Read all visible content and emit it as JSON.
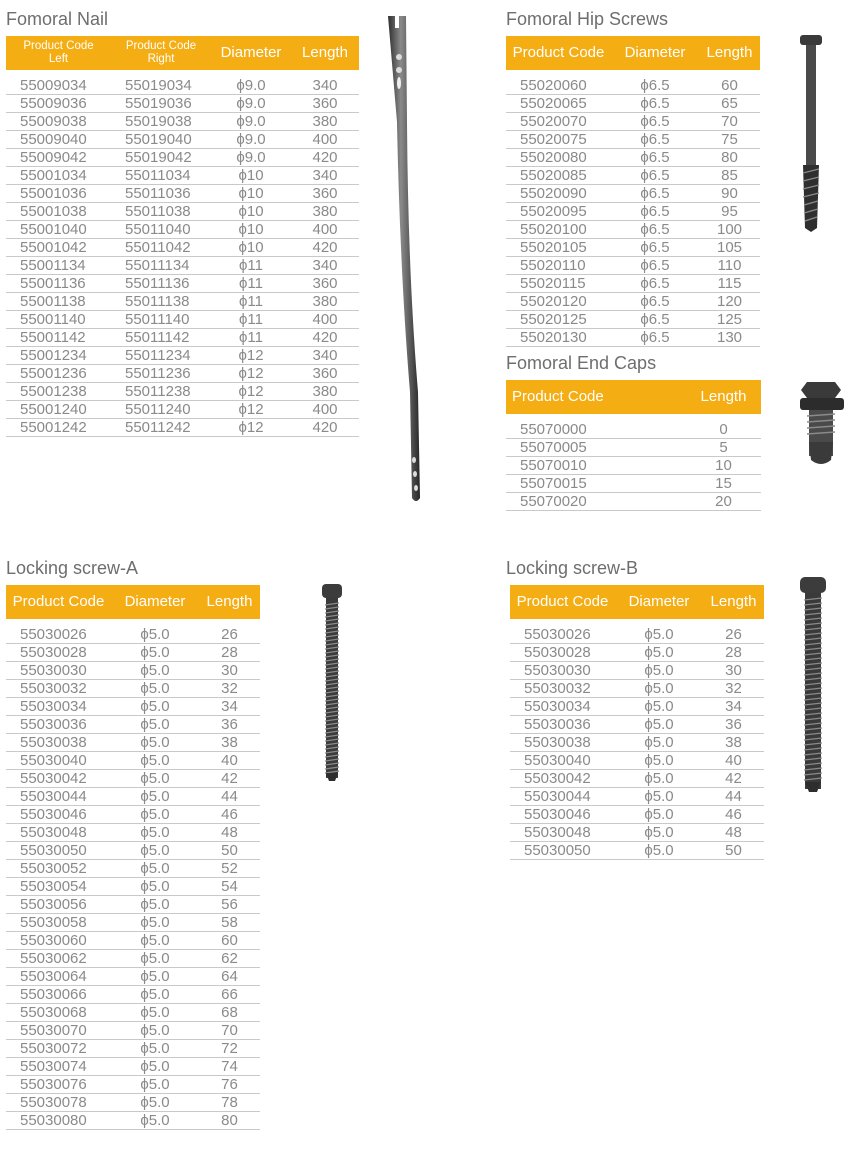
{
  "nail": {
    "title": "Fomoral Nail",
    "headers": {
      "left_top": "Product Code",
      "left_bottom": "Left",
      "right_top": "Product Code",
      "right_bottom": "Right",
      "diameter": "Diameter",
      "length": "Length"
    },
    "rows": [
      [
        "55009034",
        "55019034",
        "ϕ9.0",
        "340"
      ],
      [
        "55009036",
        "55019036",
        "ϕ9.0",
        "360"
      ],
      [
        "55009038",
        "55019038",
        "ϕ9.0",
        "380"
      ],
      [
        "55009040",
        "55019040",
        "ϕ9.0",
        "400"
      ],
      [
        "55009042",
        "55019042",
        "ϕ9.0",
        "420"
      ],
      [
        "55001034",
        "55011034",
        "ϕ10",
        "340"
      ],
      [
        "55001036",
        "55011036",
        "ϕ10",
        "360"
      ],
      [
        "55001038",
        "55011038",
        "ϕ10",
        "380"
      ],
      [
        "55001040",
        "55011040",
        "ϕ10",
        "400"
      ],
      [
        "55001042",
        "55011042",
        "ϕ10",
        "420"
      ],
      [
        "55001134",
        "55011134",
        "ϕ11",
        "340"
      ],
      [
        "55001136",
        "55011136",
        "ϕ11",
        "360"
      ],
      [
        "55001138",
        "55011138",
        "ϕ11",
        "380"
      ],
      [
        "55001140",
        "55011140",
        "ϕ11",
        "400"
      ],
      [
        "55001142",
        "55011142",
        "ϕ11",
        "420"
      ],
      [
        "55001234",
        "55011234",
        "ϕ12",
        "340"
      ],
      [
        "55001236",
        "55011236",
        "ϕ12",
        "360"
      ],
      [
        "55001238",
        "55011238",
        "ϕ12",
        "380"
      ],
      [
        "55001240",
        "55011240",
        "ϕ12",
        "400"
      ],
      [
        "55001242",
        "55011242",
        "ϕ12",
        "420"
      ]
    ]
  },
  "hip": {
    "title": "Fomoral Hip Screws",
    "headers": {
      "code": "Product Code",
      "diameter": "Diameter",
      "length": "Length"
    },
    "rows": [
      [
        "55020060",
        "ϕ6.5",
        "60"
      ],
      [
        "55020065",
        "ϕ6.5",
        "65"
      ],
      [
        "55020070",
        "ϕ6.5",
        "70"
      ],
      [
        "55020075",
        "ϕ6.5",
        "75"
      ],
      [
        "55020080",
        "ϕ6.5",
        "80"
      ],
      [
        "55020085",
        "ϕ6.5",
        "85"
      ],
      [
        "55020090",
        "ϕ6.5",
        "90"
      ],
      [
        "55020095",
        "ϕ6.5",
        "95"
      ],
      [
        "55020100",
        "ϕ6.5",
        "100"
      ],
      [
        "55020105",
        "ϕ6.5",
        "105"
      ],
      [
        "55020110",
        "ϕ6.5",
        "110"
      ],
      [
        "55020115",
        "ϕ6.5",
        "115"
      ],
      [
        "55020120",
        "ϕ6.5",
        "120"
      ],
      [
        "55020125",
        "ϕ6.5",
        "125"
      ],
      [
        "55020130",
        "ϕ6.5",
        "130"
      ]
    ]
  },
  "caps": {
    "title": "Fomoral End Caps",
    "headers": {
      "code": "Product Code",
      "length": "Length"
    },
    "rows": [
      [
        "55070000",
        "0"
      ],
      [
        "55070005",
        "5"
      ],
      [
        "55070010",
        "10"
      ],
      [
        "55070015",
        "15"
      ],
      [
        "55070020",
        "20"
      ]
    ]
  },
  "lockA": {
    "title": "Locking screw-A",
    "headers": {
      "code": "Product Code",
      "diameter": "Diameter",
      "length": "Length"
    },
    "rows": [
      [
        "55030026",
        "ϕ5.0",
        "26"
      ],
      [
        "55030028",
        "ϕ5.0",
        "28"
      ],
      [
        "55030030",
        "ϕ5.0",
        "30"
      ],
      [
        "55030032",
        "ϕ5.0",
        "32"
      ],
      [
        "55030034",
        "ϕ5.0",
        "34"
      ],
      [
        "55030036",
        "ϕ5.0",
        "36"
      ],
      [
        "55030038",
        "ϕ5.0",
        "38"
      ],
      [
        "55030040",
        "ϕ5.0",
        "40"
      ],
      [
        "55030042",
        "ϕ5.0",
        "42"
      ],
      [
        "55030044",
        "ϕ5.0",
        "44"
      ],
      [
        "55030046",
        "ϕ5.0",
        "46"
      ],
      [
        "55030048",
        "ϕ5.0",
        "48"
      ],
      [
        "55030050",
        "ϕ5.0",
        "50"
      ],
      [
        "55030052",
        "ϕ5.0",
        "52"
      ],
      [
        "55030054",
        "ϕ5.0",
        "54"
      ],
      [
        "55030056",
        "ϕ5.0",
        "56"
      ],
      [
        "55030058",
        "ϕ5.0",
        "58"
      ],
      [
        "55030060",
        "ϕ5.0",
        "60"
      ],
      [
        "55030062",
        "ϕ5.0",
        "62"
      ],
      [
        "55030064",
        "ϕ5.0",
        "64"
      ],
      [
        "55030066",
        "ϕ5.0",
        "66"
      ],
      [
        "55030068",
        "ϕ5.0",
        "68"
      ],
      [
        "55030070",
        "ϕ5.0",
        "70"
      ],
      [
        "55030072",
        "ϕ5.0",
        "72"
      ],
      [
        "55030074",
        "ϕ5.0",
        "74"
      ],
      [
        "55030076",
        "ϕ5.0",
        "76"
      ],
      [
        "55030078",
        "ϕ5.0",
        "78"
      ],
      [
        "55030080",
        "ϕ5.0",
        "80"
      ]
    ]
  },
  "lockB": {
    "title": "Locking screw-B",
    "headers": {
      "code": "Product Code",
      "diameter": "Diameter",
      "length": "Length"
    },
    "rows": [
      [
        "55030026",
        "ϕ5.0",
        "26"
      ],
      [
        "55030028",
        "ϕ5.0",
        "28"
      ],
      [
        "55030030",
        "ϕ5.0",
        "30"
      ],
      [
        "55030032",
        "ϕ5.0",
        "32"
      ],
      [
        "55030034",
        "ϕ5.0",
        "34"
      ],
      [
        "55030036",
        "ϕ5.0",
        "36"
      ],
      [
        "55030038",
        "ϕ5.0",
        "38"
      ],
      [
        "55030040",
        "ϕ5.0",
        "40"
      ],
      [
        "55030042",
        "ϕ5.0",
        "42"
      ],
      [
        "55030044",
        "ϕ5.0",
        "44"
      ],
      [
        "55030046",
        "ϕ5.0",
        "46"
      ],
      [
        "55030048",
        "ϕ5.0",
        "48"
      ],
      [
        "55030050",
        "ϕ5.0",
        "50"
      ]
    ]
  },
  "colors": {
    "header": "#f5ad14",
    "rule": "#c9c9c9",
    "text": "#8a8a8a",
    "title": "#6e6e6e"
  }
}
